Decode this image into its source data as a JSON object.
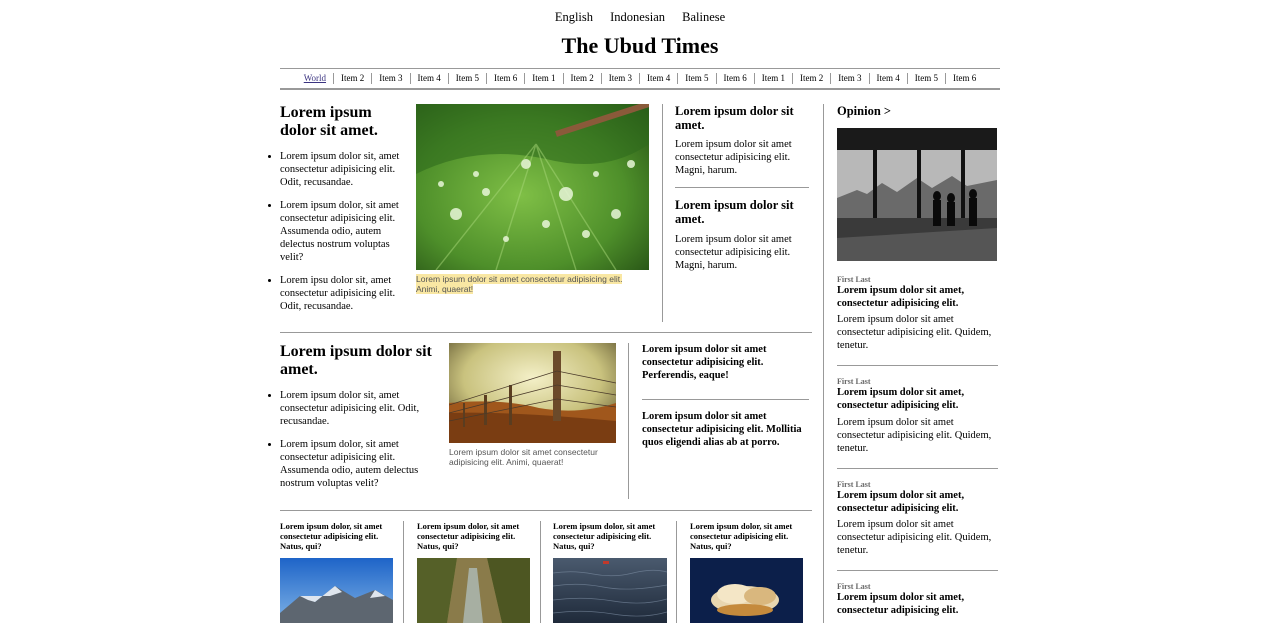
{
  "languages": [
    "English",
    "Indonesian",
    "Balinese"
  ],
  "masthead": "The Ubud Times",
  "nav": [
    "World",
    "Item 2",
    "Item 3",
    "Item 4",
    "Item 5",
    "Item 6",
    "Item 1",
    "Item 2",
    "Item 3",
    "Item 4",
    "Item 5",
    "Item 6",
    "Item 1",
    "Item 2",
    "Item 3",
    "Item 4",
    "Item 5",
    "Item 6"
  ],
  "lead": {
    "title": "Lorem ipsum dolor sit amet.",
    "bullets": [
      "Lorem ipsum dolor sit, amet consectetur adipisicing elit. Odit, recusandae.",
      "Lorem ipsum dolor, sit amet consectetur adipisicing elit. Assumenda odio, autem delectus nostrum voluptas velit?",
      "Lorem ipsu dolor sit, amet consectetur adipisicing elit. Odit, recusandae."
    ],
    "caption": "Lorem ipsum dolor sit amet consectetur adipisicing elit. Animi, quaerat!"
  },
  "side_stories": [
    {
      "title": "Lorem ipsum dolor sit amet.",
      "body": "Lorem ipsum dolor sit amet consectetur adipisicing elit. Magni, harum."
    },
    {
      "title": "Lorem ipsum dolor sit amet.",
      "body": "Lorem ipsum dolor sit amet consectetur adipisicing elit. Magni, harum."
    }
  ],
  "second": {
    "title": "Lorem ipsum dolor sit amet.",
    "bullets": [
      "Lorem ipsum dolor sit, amet consectetur adipisicing elit. Odit, recusandae.",
      "Lorem ipsum dolor, sit amet consectetur adipisicing elit. Assumenda odio, autem delectus nostrum voluptas velit?"
    ],
    "caption": "Lorem ipsum dolor sit amet consectetur adipisicing elit. Animi, quaerat!",
    "briefs": [
      "Lorem ipsum dolor sit amet consectetur adipisicing elit. Perferendis, eaque!",
      "Lorem ipsum dolor sit amet consectetur adipisicing elit. Mollitia quos eligendi alias ab at porro."
    ]
  },
  "bottom_row": [
    "Lorem ipsum dolor, sit amet consectetur adipisicing elit. Natus, qui?",
    "Lorem ipsum dolor, sit amet consectetur adipisicing elit. Natus, qui?",
    "Lorem ipsum dolor, sit amet consectetur adipisicing elit. Natus, qui?",
    "Lorem ipsum dolor, sit amet consectetur adipisicing elit. Natus, qui?"
  ],
  "opinion": {
    "heading": "Opinion >",
    "items": [
      {
        "author": "First Last",
        "title": "Lorem ipsum dolor sit amet, consectetur adipisicing elit.",
        "body": "Lorem ipsum dolor sit amet consectetur adipisicing elit. Quidem, tenetur."
      },
      {
        "author": "First Last",
        "title": "Lorem ipsum dolor sit amet, consectetur adipisicing elit.",
        "body": "Lorem ipsum dolor sit amet consectetur adipisicing elit. Quidem, tenetur."
      },
      {
        "author": "First Last",
        "title": "Lorem ipsum dolor sit amet, consectetur adipisicing elit.",
        "body": "Lorem ipsum dolor sit amet consectetur adipisicing elit. Quidem, tenetur."
      },
      {
        "author": "First Last",
        "title": "Lorem ipsum dolor sit amet, consectetur adipisicing elit."
      }
    ]
  }
}
